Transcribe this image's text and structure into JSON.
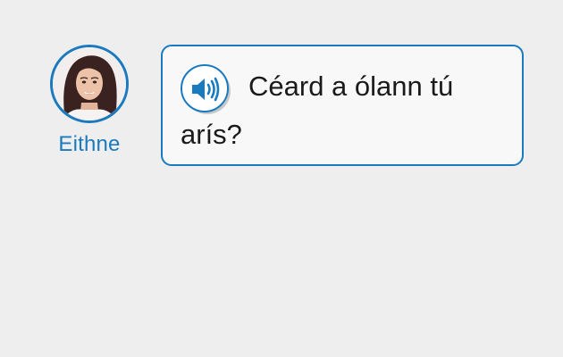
{
  "speaker": {
    "name": "Eithne",
    "avatar_icon": "woman-portrait-avatar"
  },
  "message": {
    "text": "Céard a ólann tú arís?",
    "audio_icon": "speaker-volume-icon"
  },
  "colors": {
    "accent": "#1a7abf",
    "background": "#eeeeee",
    "bubble_background": "#f8f8f8",
    "text": "#1a1a1a"
  }
}
